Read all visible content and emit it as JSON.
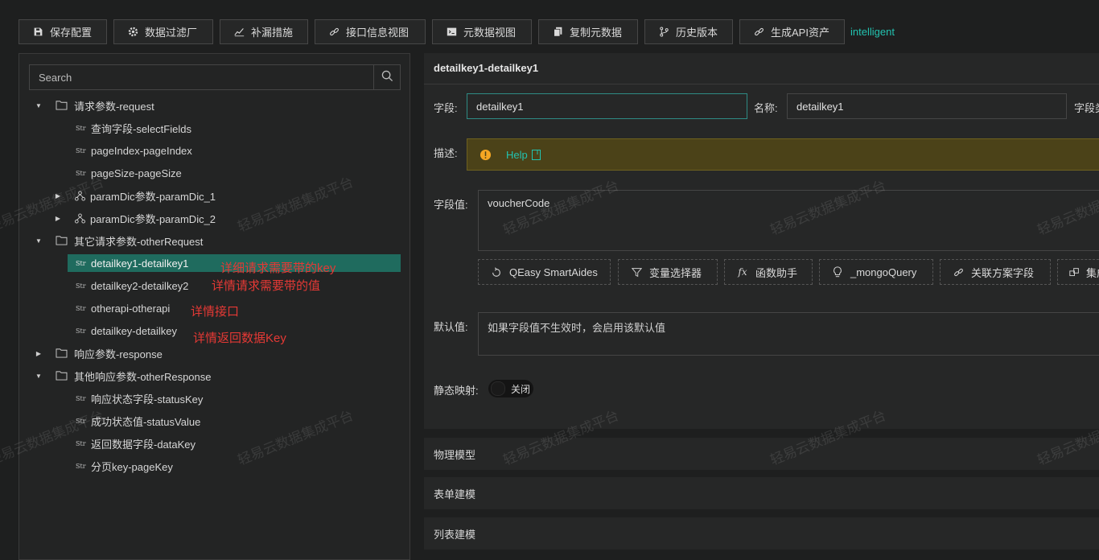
{
  "toolbar": {
    "buttons": [
      {
        "label": "保存配置",
        "icon": "save-icon"
      },
      {
        "label": "数据过滤厂",
        "icon": "gear-icon"
      },
      {
        "label": "补漏措施",
        "icon": "chart-line-icon"
      },
      {
        "label": "接口信息视图",
        "icon": "link-icon"
      },
      {
        "label": "元数据视图",
        "icon": "terminal-icon"
      },
      {
        "label": "复制元数据",
        "icon": "copy-icon"
      },
      {
        "label": "历史版本",
        "icon": "branch-icon"
      },
      {
        "label": "生成API资产",
        "icon": "link-icon"
      }
    ],
    "link_text": "intelligent"
  },
  "search": {
    "placeholder": "Search"
  },
  "tree": [
    {
      "label": "请求参数-request",
      "type": "folder",
      "expanded": true
    },
    {
      "label": "查询字段-selectFields",
      "type": "str"
    },
    {
      "label": "pageIndex-pageIndex",
      "type": "str"
    },
    {
      "label": "pageSize-pageSize",
      "type": "str"
    },
    {
      "label": "paramDic参数-paramDic_1",
      "type": "node",
      "expanded": false
    },
    {
      "label": "paramDic参数-paramDic_2",
      "type": "node",
      "expanded": false
    },
    {
      "label": "其它请求参数-otherRequest",
      "type": "folder",
      "expanded": true
    },
    {
      "label": "detailkey1-detailkey1",
      "type": "str",
      "selected": true
    },
    {
      "label": "detailkey2-detailkey2",
      "type": "str"
    },
    {
      "label": "otherapi-otherapi",
      "type": "str"
    },
    {
      "label": "detailkey-detailkey",
      "type": "str"
    },
    {
      "label": "响应参数-response",
      "type": "folder",
      "expanded": false
    },
    {
      "label": "其他响应参数-otherResponse",
      "type": "folder",
      "expanded": true
    },
    {
      "label": "响应状态字段-statusKey",
      "type": "str"
    },
    {
      "label": "成功状态值-statusValue",
      "type": "str"
    },
    {
      "label": "返回数据字段-dataKey",
      "type": "str"
    },
    {
      "label": "分页key-pageKey",
      "type": "str"
    }
  ],
  "str_badge": "Str",
  "annotations": [
    "详细请求需要带的key",
    "详情请求需要带的值",
    "详情接口",
    "详情返回数据Key"
  ],
  "detail": {
    "title": "detailkey1-detailkey1",
    "field_label": "字段:",
    "field_value": "detailkey1",
    "name_label": "名称:",
    "name_value": "detailkey1",
    "extra_label": "字段类型",
    "desc_label": "描述:",
    "help_text": "Help",
    "value_label": "字段值:",
    "value_text": "voucherCode",
    "action_buttons": [
      {
        "label": "QEasy SmartAides",
        "icon": "magic-icon"
      },
      {
        "label": "变量选择器",
        "icon": "filter-icon"
      },
      {
        "label": "函数助手",
        "icon": "function-icon"
      },
      {
        "label": "_mongoQuery",
        "icon": "bulb-icon"
      },
      {
        "label": "关联方案字段",
        "icon": "link-icon"
      },
      {
        "label": "集成",
        "icon": "group-icon"
      }
    ],
    "default_label": "默认值:",
    "default_placeholder": "如果字段值不生效时，会启用该默认值",
    "static_label": "静态映射:",
    "toggle_text": "关闭"
  },
  "sections": [
    "物理模型",
    "表单建模",
    "列表建模"
  ],
  "watermark": "轻易云数据集成平台",
  "colors": {
    "accent": "#22c3b0",
    "selected": "#1f6b5e",
    "warning_bg": "#4b4218",
    "annotation": "#e53935"
  }
}
